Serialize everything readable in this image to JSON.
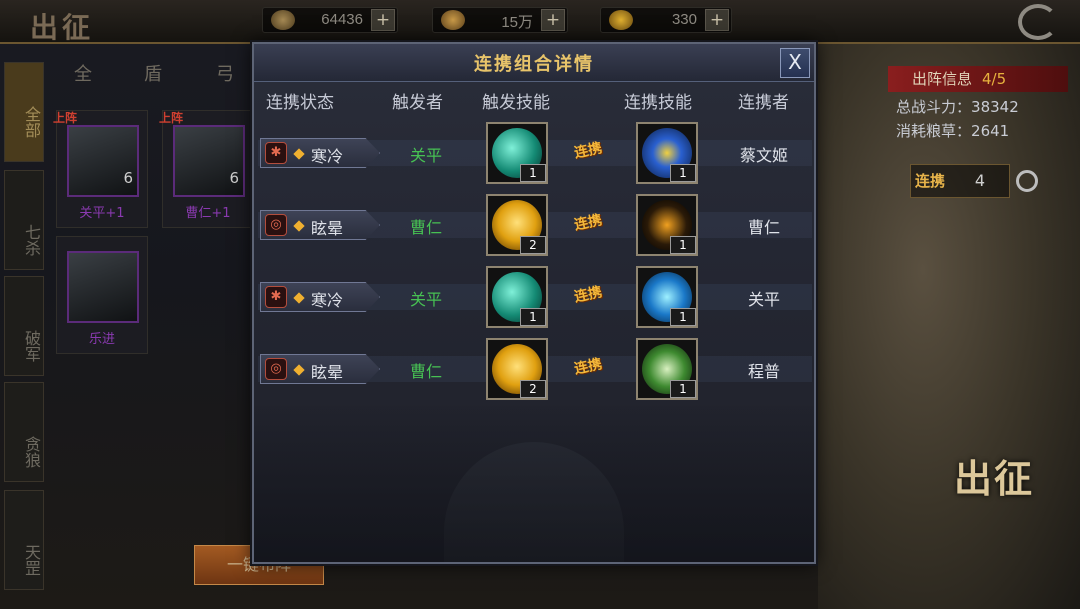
{
  "topbar": {
    "title": "出征",
    "resources": [
      {
        "icon": "wheat-icon",
        "value": "64436",
        "plus": "+"
      },
      {
        "icon": "coin-icon",
        "value": "15万",
        "plus": "+"
      },
      {
        "icon": "ingot-icon",
        "value": "330",
        "plus": "+"
      }
    ]
  },
  "leftnav": {
    "items": [
      {
        "label": "全部",
        "active": true
      },
      {
        "label": "七杀"
      },
      {
        "label": "破军"
      },
      {
        "label": "贪狼"
      },
      {
        "label": "天罡"
      }
    ]
  },
  "category_tabs": [
    "全",
    "盾",
    "弓"
  ],
  "hero_cards": [
    {
      "badge": "上阵",
      "count": "6",
      "name": "关平+1"
    },
    {
      "badge": "上阵",
      "count": "6",
      "name": "曹仁+1"
    },
    {
      "badge": "",
      "count": "",
      "name": "乐进"
    }
  ],
  "deploy_button": "一键布阵",
  "info_panel": {
    "title": "出阵信息",
    "count": "4/5",
    "power_label": "总战斗力",
    "power_value": "38342",
    "grain_label": "消耗粮草",
    "grain_value": "2641"
  },
  "combo_counter": {
    "label": "连携",
    "value": "4"
  },
  "march_button": "出征",
  "modal": {
    "title": "连携组合详情",
    "close": "X",
    "headers": {
      "status": "连携状态",
      "trigger": "触发者",
      "trigger_skill": "触发技能",
      "combo_skill": "连携技能",
      "partner": "连携者"
    },
    "link_text": "连携",
    "rows": [
      {
        "status": "寒冷",
        "trigger": "关平",
        "trigger_skill_icon": "ice-claw-icon",
        "trigger_skill_level": "1",
        "combo_skill_icon": "lightning-z-icon",
        "combo_skill_level": "1",
        "partner": "蔡文姬"
      },
      {
        "status": "眩晕",
        "trigger": "曹仁",
        "trigger_skill_icon": "golden-shield-icon",
        "trigger_skill_level": "2",
        "combo_skill_icon": "dark-strike-icon",
        "combo_skill_level": "1",
        "partner": "曹仁"
      },
      {
        "status": "寒冷",
        "trigger": "关平",
        "trigger_skill_icon": "ice-claw-icon",
        "trigger_skill_level": "1",
        "combo_skill_icon": "ice-fist-icon",
        "combo_skill_level": "1",
        "partner": "关平"
      },
      {
        "status": "眩晕",
        "trigger": "曹仁",
        "trigger_skill_icon": "golden-shield-icon",
        "trigger_skill_level": "2",
        "combo_skill_icon": "roar-skull-icon",
        "combo_skill_level": "1",
        "partner": "程普"
      }
    ]
  },
  "colors": {
    "accent_gold": "#e8c46a",
    "trigger_green": "#47c153",
    "link_orange": "#f3b73a",
    "panel_red": "#8a1e1e"
  }
}
